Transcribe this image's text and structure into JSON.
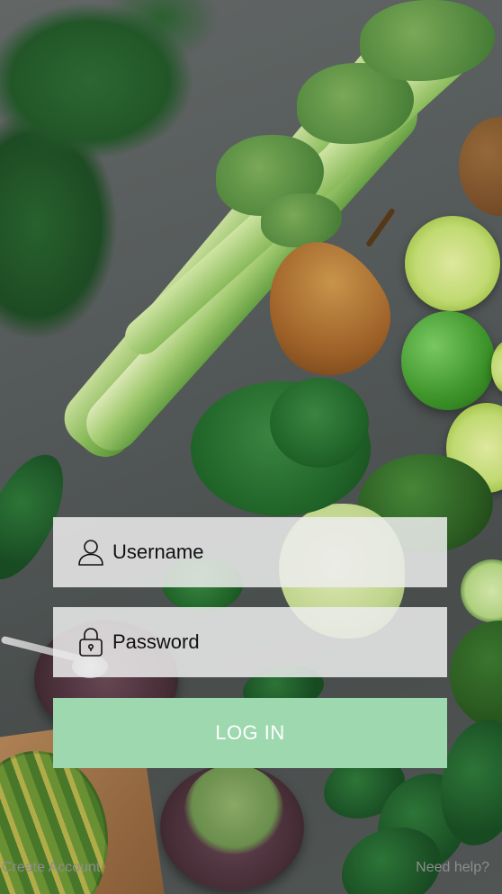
{
  "login_form": {
    "username_placeholder": "Username",
    "password_placeholder": "Password",
    "login_label": "LOG IN"
  },
  "footer": {
    "create_account": "Create Account",
    "need_help": "Need help?"
  },
  "icons": {
    "username": "user-icon",
    "password": "lock-icon"
  },
  "colors": {
    "field_background": "#ececec",
    "login_button": "#9ed8af",
    "login_text": "#ffffff",
    "footer_text": "#8d8d8d"
  }
}
